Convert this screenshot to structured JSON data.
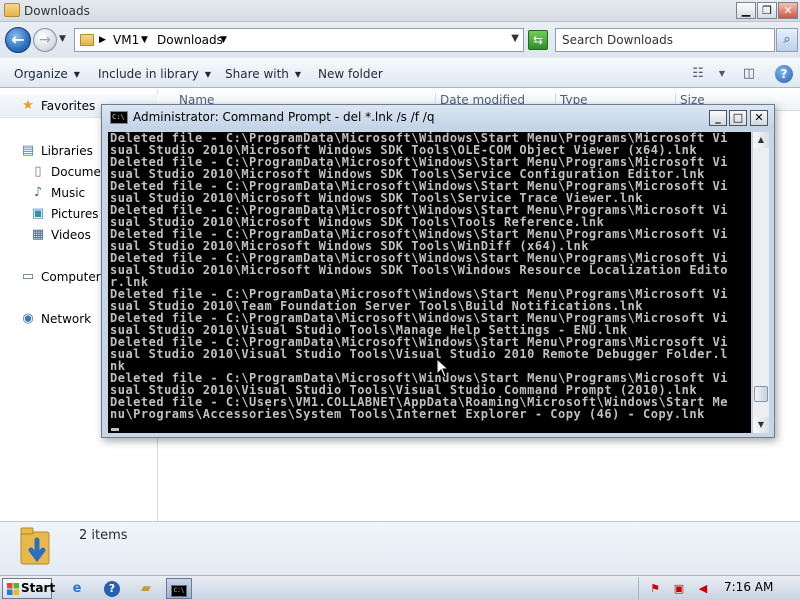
{
  "explorer": {
    "window_title": "Downloads",
    "caption_buttons": {
      "minimize": "▁",
      "maximize": "❐",
      "close": "✕"
    },
    "address": {
      "segments": [
        "VM1",
        "Downloads"
      ]
    },
    "search": {
      "placeholder": "Search Downloads",
      "value": ""
    },
    "toolbar": {
      "organize": "Organize",
      "include_in_library": "Include in library",
      "share_with": "Share with",
      "new_folder": "New folder"
    },
    "nav": {
      "favorites": "Favorites",
      "libraries": "Libraries",
      "library_items": [
        "Documen",
        "Music",
        "Pictures",
        "Videos"
      ],
      "computer": "Computer",
      "network": "Network"
    },
    "column_headers": [
      "Name",
      "Date modified",
      "Type",
      "Size"
    ],
    "details": {
      "item_count": "2 items"
    }
  },
  "cmd_window": {
    "title": "Administrator:  Command Prompt - del  *.lnk /s /f /q",
    "console_lines": [
      "Deleted file - C:\\ProgramData\\Microsoft\\Windows\\Start Menu\\Programs\\Microsoft Vi",
      "sual Studio 2010\\Microsoft Windows SDK Tools\\OLE-COM Object Viewer (x64).lnk",
      "Deleted file - C:\\ProgramData\\Microsoft\\Windows\\Start Menu\\Programs\\Microsoft Vi",
      "sual Studio 2010\\Microsoft Windows SDK Tools\\Service Configuration Editor.lnk",
      "Deleted file - C:\\ProgramData\\Microsoft\\Windows\\Start Menu\\Programs\\Microsoft Vi",
      "sual Studio 2010\\Microsoft Windows SDK Tools\\Service Trace Viewer.lnk",
      "Deleted file - C:\\ProgramData\\Microsoft\\Windows\\Start Menu\\Programs\\Microsoft Vi",
      "sual Studio 2010\\Microsoft Windows SDK Tools\\Tools Reference.lnk",
      "Deleted file - C:\\ProgramData\\Microsoft\\Windows\\Start Menu\\Programs\\Microsoft Vi",
      "sual Studio 2010\\Microsoft Windows SDK Tools\\WinDiff (x64).lnk",
      "Deleted file - C:\\ProgramData\\Microsoft\\Windows\\Start Menu\\Programs\\Microsoft Vi",
      "sual Studio 2010\\Microsoft Windows SDK Tools\\Windows Resource Localization Edito",
      "r.lnk",
      "Deleted file - C:\\ProgramData\\Microsoft\\Windows\\Start Menu\\Programs\\Microsoft Vi",
      "sual Studio 2010\\Team Foundation Server Tools\\Build Notifications.lnk",
      "Deleted file - C:\\ProgramData\\Microsoft\\Windows\\Start Menu\\Programs\\Microsoft Vi",
      "sual Studio 2010\\Visual Studio Tools\\Manage Help Settings - ENU.lnk",
      "Deleted file - C:\\ProgramData\\Microsoft\\Windows\\Start Menu\\Programs\\Microsoft Vi",
      "sual Studio 2010\\Visual Studio Tools\\Visual Studio 2010 Remote Debugger Folder.l",
      "nk",
      "Deleted file - C:\\ProgramData\\Microsoft\\Windows\\Start Menu\\Programs\\Microsoft Vi",
      "sual Studio 2010\\Visual Studio Tools\\Visual Studio Command Prompt (2010).lnk",
      "Deleted file - C:\\Users\\VM1.COLLABNET\\AppData\\Roaming\\Microsoft\\Windows\\Start Me",
      "nu\\Programs\\Accessories\\System Tools\\Internet Explorer - Copy (46) - Copy.lnk"
    ],
    "scrollbar_position": 0.95
  },
  "taskbar": {
    "start_label": "Start",
    "clock": "7:16 AM"
  },
  "colors": {
    "console_bg": "#000000",
    "console_fg": "#c0c0c0",
    "accent": "#2a6fc2"
  }
}
